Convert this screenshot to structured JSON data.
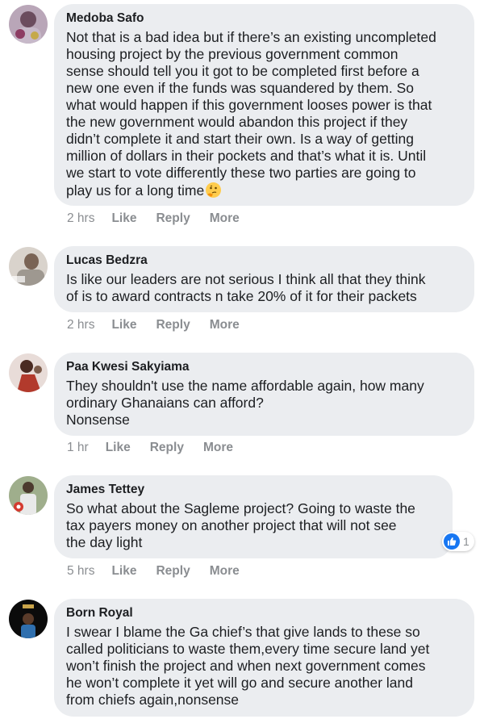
{
  "comments": [
    {
      "author": "Medoba Safo",
      "text": "Not that is a bad idea but if there’s an existing uncompleted\nhousing project by the previous government common\nsense should tell you it got to be completed first before a\nnew one even if the funds was squandered by them. So\nwhat would happen if this government looses power is that\nthe new government would abandon this project if they\ndidn’t complete it and start their own. Is a way of getting\nmillion of dollars in their pockets and that’s what it is. Until\nwe start to vote differently these two parties are going to\nplay us for a long time",
      "emoji": "thinking-face",
      "time": "2 hrs",
      "like": "Like",
      "reply": "Reply",
      "more": "More"
    },
    {
      "author": "Lucas Bedzra",
      "text": "Is like our leaders are not serious I think all that they think\nof is to award contracts n take 20% of it for their packets",
      "time": "2 hrs",
      "like": "Like",
      "reply": "Reply",
      "more": "More"
    },
    {
      "author": "Paa Kwesi Sakyiama",
      "text": "They shouldn't use the name affordable again, how many\nordinary Ghanaians can afford?\nNonsense",
      "time": "1 hr",
      "like": "Like",
      "reply": "Reply",
      "more": "More"
    },
    {
      "author": "James Tettey",
      "text": "So what about the Sagleme project? Going to waste the\ntax payers money on another project that will not see\nthe day light",
      "time": "5 hrs",
      "like": "Like",
      "reply": "Reply",
      "more": "More",
      "reaction": {
        "icon": "thumbs-up-icon",
        "count": "1",
        "color": "#1877f2"
      }
    },
    {
      "author": "Born Royal",
      "text": "I swear I blame the Ga chief’s that give lands to these so\ncalled politicians to waste them,every time secure land yet\nwon’t finish the project and when next government comes\nhe won’t complete it yet will go and secure another land\nfrom chiefs again,nonsense"
    }
  ],
  "colors": {
    "bubble": "#ebedf0",
    "text": "#1c1e21",
    "meta": "#8a8d91",
    "accent": "#1877f2"
  }
}
